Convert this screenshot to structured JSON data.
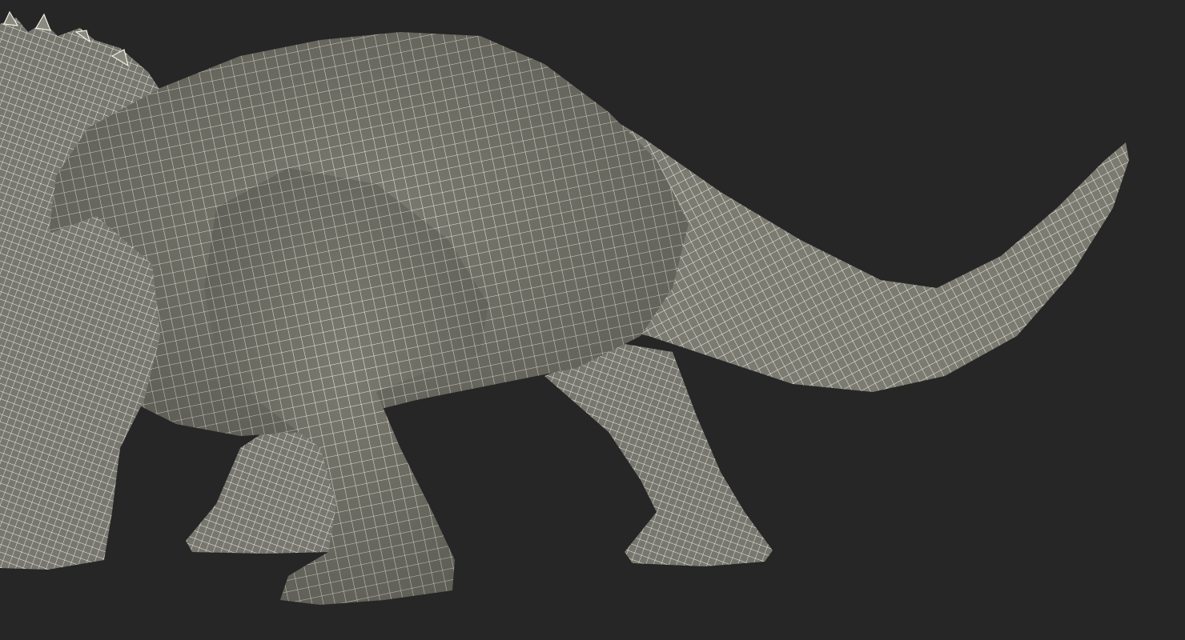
{
  "scene": {
    "background_color": "#262626",
    "mesh_fill_color": "#7a7a70",
    "mesh_shade_color": "#5f5f57",
    "wire_color": "#f4f1e4",
    "subject_icon": "triceratops-wireframe-model"
  }
}
